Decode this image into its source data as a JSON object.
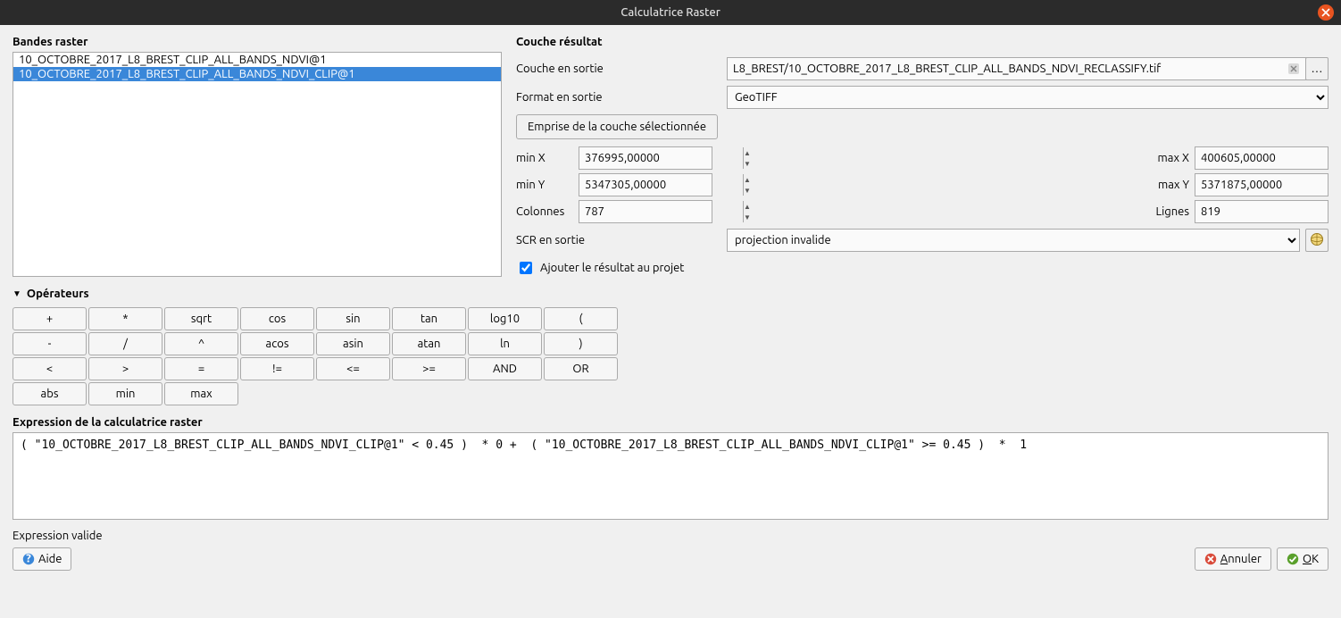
{
  "title": "Calculatrice Raster",
  "raster_bands": {
    "header": "Bandes raster",
    "items": [
      {
        "label": "10_OCTOBRE_2017_L8_BREST_CLIP_ALL_BANDS_NDVI@1",
        "selected": false
      },
      {
        "label": "10_OCTOBRE_2017_L8_BREST_CLIP_ALL_BANDS_NDVI_CLIP@1",
        "selected": true
      }
    ]
  },
  "result": {
    "header": "Couche résultat",
    "output_layer_label": "Couche en sortie",
    "output_layer_value": "L8_BREST/10_OCTOBRE_2017_L8_BREST_CLIP_ALL_BANDS_NDVI_RECLASSIFY.tif",
    "output_format_label": "Format en sortie",
    "output_format_value": "GeoTIFF",
    "extent_button": "Emprise de la couche sélectionnée",
    "min_x_label": "min X",
    "min_x_value": "376995,00000",
    "max_x_label": "max X",
    "max_x_value": "400605,00000",
    "min_y_label": "min Y",
    "min_y_value": "5347305,00000",
    "max_y_label": "max Y",
    "max_y_value": "5371875,00000",
    "cols_label": "Colonnes",
    "cols_value": "787",
    "rows_label": "Lignes",
    "rows_value": "819",
    "crs_label": "SCR en sortie",
    "crs_value": "projection invalide",
    "add_to_project_label": "Ajouter le résultat au projet",
    "add_to_project_checked": true,
    "browse_label": "…"
  },
  "operators": {
    "header": "Opérateurs",
    "rows": [
      [
        "+",
        "*",
        "sqrt",
        "cos",
        "sin",
        "tan",
        "log10",
        "("
      ],
      [
        "-",
        "/",
        "^",
        "acos",
        "asin",
        "atan",
        "ln",
        ")"
      ],
      [
        "<",
        ">",
        "=",
        "!=",
        "<=",
        ">=",
        "AND",
        "OR"
      ],
      [
        "abs",
        "min",
        "max"
      ]
    ]
  },
  "expression": {
    "header": "Expression de la calculatrice raster",
    "value": "( \"10_OCTOBRE_2017_L8_BREST_CLIP_ALL_BANDS_NDVI_CLIP@1\" < 0.45 )  * 0 +  ( \"10_OCTOBRE_2017_L8_BREST_CLIP_ALL_BANDS_NDVI_CLIP@1\" >= 0.45 )  *  1"
  },
  "status": "Expression valide",
  "footer": {
    "help": "Aide",
    "cancel": "Annuler",
    "ok": "OK"
  }
}
